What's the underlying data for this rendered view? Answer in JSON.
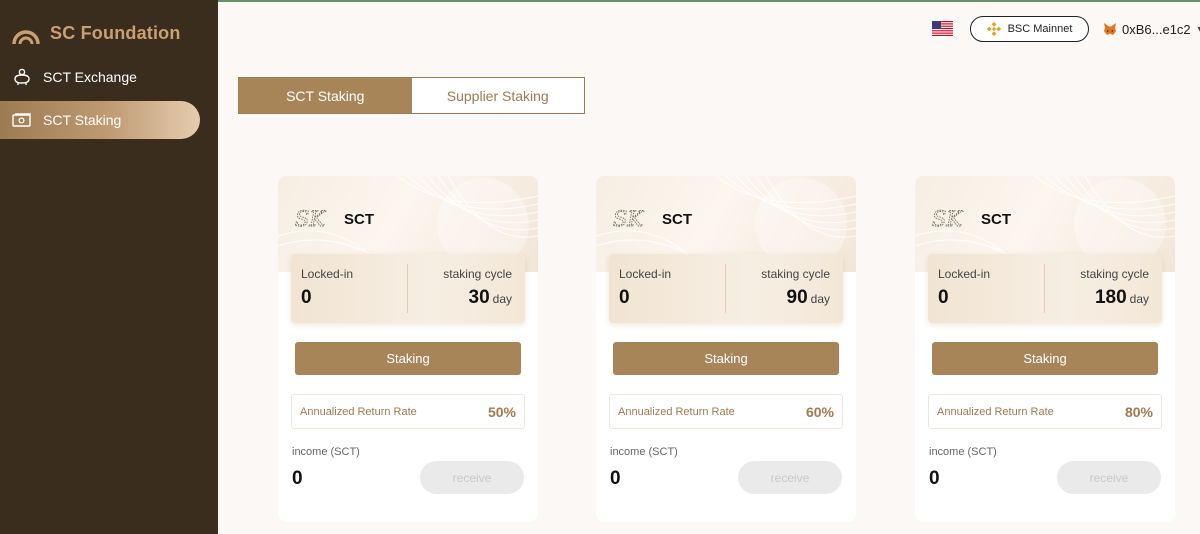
{
  "app": {
    "brand_name": "SC Foundation",
    "accent_color": "#a88559",
    "sidebar_color": "#3a2d1e"
  },
  "sidebar": {
    "items": [
      {
        "label": "SCT Exchange",
        "icon": "piggy-bank-icon",
        "active": false
      },
      {
        "label": "SCT Staking",
        "icon": "money-stack-icon",
        "active": true
      }
    ]
  },
  "header": {
    "language_icon": "us-flag-icon",
    "network_label": "BSC Mainnet",
    "network_icon": "bnb-icon",
    "wallet_address": "0xB6...e1c2",
    "wallet_icon": "metamask-fox-icon"
  },
  "tabs": [
    {
      "label": "SCT Staking",
      "active": true
    },
    {
      "label": "Supplier Staking",
      "active": false
    }
  ],
  "cards": [
    {
      "coin": "SCT",
      "locked_label": "Locked-in",
      "locked_value": "0",
      "cycle_label": "staking cycle",
      "cycle_value": "30",
      "cycle_unit": "day",
      "stake_label": "Staking",
      "rate_label": "Annualized Return Rate",
      "rate_value": "50%",
      "income_label": "income (SCT)",
      "income_value": "0",
      "receive_label": "receive"
    },
    {
      "coin": "SCT",
      "locked_label": "Locked-in",
      "locked_value": "0",
      "cycle_label": "staking cycle",
      "cycle_value": "90",
      "cycle_unit": "day",
      "stake_label": "Staking",
      "rate_label": "Annualized Return Rate",
      "rate_value": "60%",
      "income_label": "income (SCT)",
      "income_value": "0",
      "receive_label": "receive"
    },
    {
      "coin": "SCT",
      "locked_label": "Locked-in",
      "locked_value": "0",
      "cycle_label": "staking cycle",
      "cycle_value": "180",
      "cycle_unit": "day",
      "stake_label": "Staking",
      "rate_label": "Annualized Return Rate",
      "rate_value": "80%",
      "income_label": "income (SCT)",
      "income_value": "0",
      "receive_label": "receive"
    }
  ]
}
